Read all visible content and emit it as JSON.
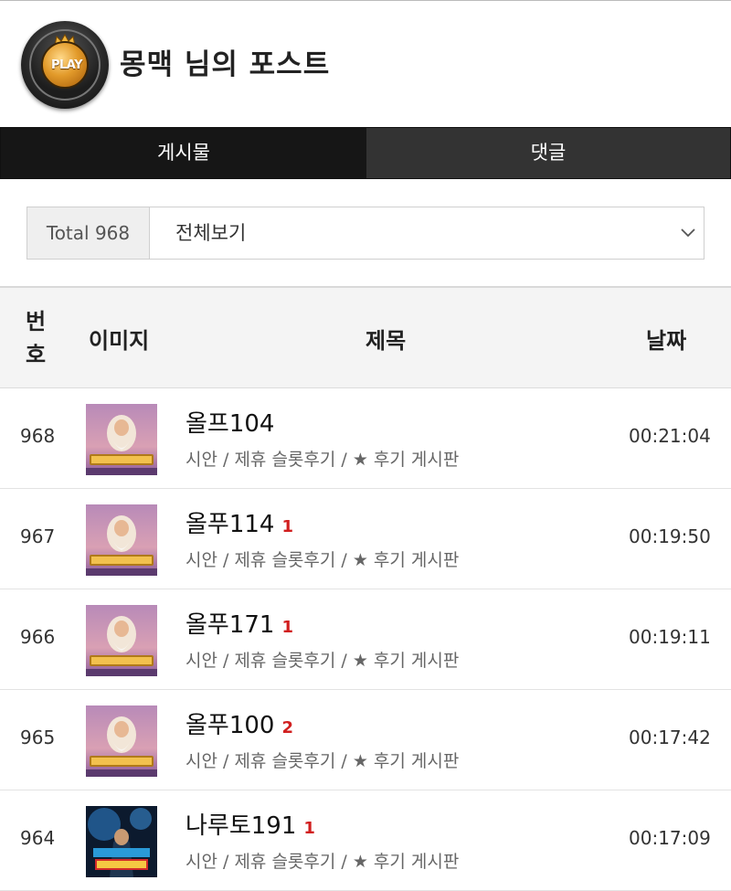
{
  "header": {
    "title": "몽맥 님의 포스트",
    "avatar_text": "PLAY"
  },
  "tabs": [
    {
      "label": "게시물",
      "active": true
    },
    {
      "label": "댓글",
      "active": false
    }
  ],
  "filter": {
    "total_label": "Total 968",
    "selected": "전체보기"
  },
  "table": {
    "headers": {
      "number": "번호",
      "image": "이미지",
      "title": "제목",
      "date": "날짜"
    },
    "rows": [
      {
        "number": "968",
        "image": "gates-of-olympus",
        "title": "올프104",
        "comments": "",
        "sub": "시안 / 제휴 슬롯후기 / ★ 후기 게시판",
        "time": "00:21:04"
      },
      {
        "number": "967",
        "image": "gates-of-olympus",
        "title": "올푸114",
        "comments": "1",
        "sub": "시안 / 제휴 슬롯후기 / ★ 후기 게시판",
        "time": "00:19:50"
      },
      {
        "number": "966",
        "image": "gates-of-olympus",
        "title": "올푸171",
        "comments": "1",
        "sub": "시안 / 제휴 슬롯후기 / ★ 후기 게시판",
        "time": "00:19:11"
      },
      {
        "number": "965",
        "image": "gates-of-olympus",
        "title": "올푸100",
        "comments": "2",
        "sub": "시안 / 제휴 슬롯후기 / ★ 후기 게시판",
        "time": "00:17:42"
      },
      {
        "number": "964",
        "image": "power-of-ninja",
        "title": "나루토191",
        "comments": "1",
        "sub": "시안 / 제휴 슬롯후기 / ★ 후기 게시판",
        "time": "00:17:09"
      }
    ]
  },
  "colors": {
    "tab_active": "#161616",
    "tab_inactive": "#333333",
    "comment_count": "#d11f1f"
  }
}
